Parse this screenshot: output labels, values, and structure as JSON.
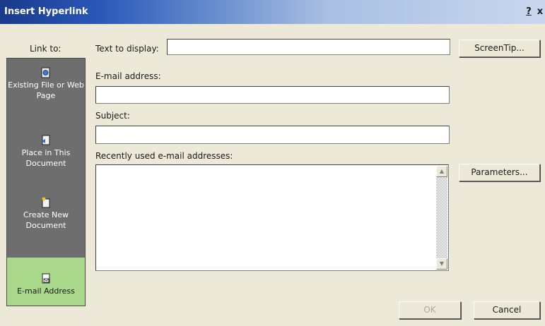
{
  "window": {
    "title": "Insert Hyperlink",
    "help_label": "?",
    "close_label": "x"
  },
  "link_to": {
    "label": "Link to:",
    "items": [
      {
        "label": "Existing File or Web Page",
        "icon": "web-page-icon",
        "selected": false
      },
      {
        "label": "Place in This Document",
        "icon": "document-place-icon",
        "selected": false
      },
      {
        "label": "Create New Document",
        "icon": "new-document-icon",
        "selected": false
      },
      {
        "label": "E-mail Address",
        "icon": "email-address-icon",
        "selected": true
      }
    ]
  },
  "form": {
    "text_to_display_label": "Text to display:",
    "text_to_display_value": "",
    "email_label": "E-mail address:",
    "email_value": "",
    "subject_label": "Subject:",
    "subject_value": "",
    "recent_label": "Recently used e-mail addresses:",
    "recent_items": []
  },
  "buttons": {
    "screentip": "ScreenTip...",
    "parameters": "Parameters...",
    "ok": "OK",
    "cancel": "Cancel"
  },
  "colors": {
    "selected_link": "#a9d88a",
    "link_bar": "#6e6e6e",
    "dialog_bg": "#ece9d8"
  }
}
